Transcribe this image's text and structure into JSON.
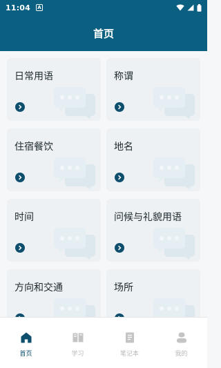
{
  "status_bar": {
    "time": "11:04",
    "notification_letter": "A"
  },
  "header": {
    "title": "首页"
  },
  "categories": [
    {
      "label": "日常用语"
    },
    {
      "label": "称谓"
    },
    {
      "label": "住宿餐饮"
    },
    {
      "label": "地名"
    },
    {
      "label": "时间"
    },
    {
      "label": "问候与礼貌用语"
    },
    {
      "label": "方向和交通"
    },
    {
      "label": "场所"
    }
  ],
  "tabs": [
    {
      "label": "首页",
      "active": true,
      "icon": "home-icon"
    },
    {
      "label": "学习",
      "active": false,
      "icon": "book-icon"
    },
    {
      "label": "笔记本",
      "active": false,
      "icon": "notebook-icon"
    },
    {
      "label": "我的",
      "active": false,
      "icon": "user-icon"
    }
  ],
  "colors": {
    "brand": "#0b5f80",
    "card_background": "#edf1f3",
    "arrow": "#0f4f6e",
    "tab_inactive": "#b9b9b9"
  }
}
